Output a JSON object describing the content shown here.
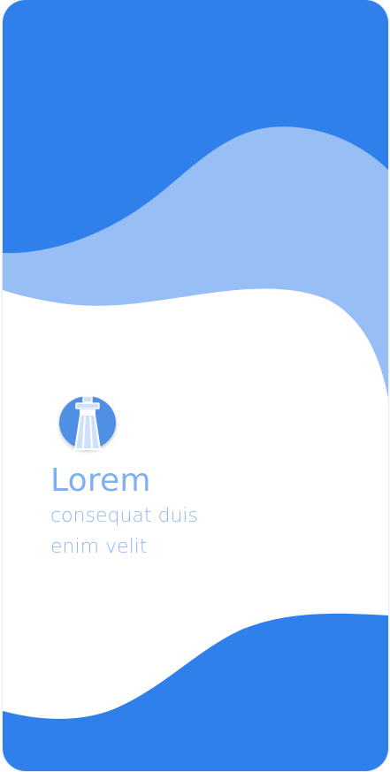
{
  "splash": {
    "title": "Lorem",
    "subtitle": "consequat duis enim velit"
  },
  "icons": {
    "logo": "lighthouse-tower-icon"
  },
  "colors": {
    "primary": "#2f80ea",
    "light": "#97bef5",
    "text": "#7fb0f1",
    "background": "#ffffff"
  }
}
